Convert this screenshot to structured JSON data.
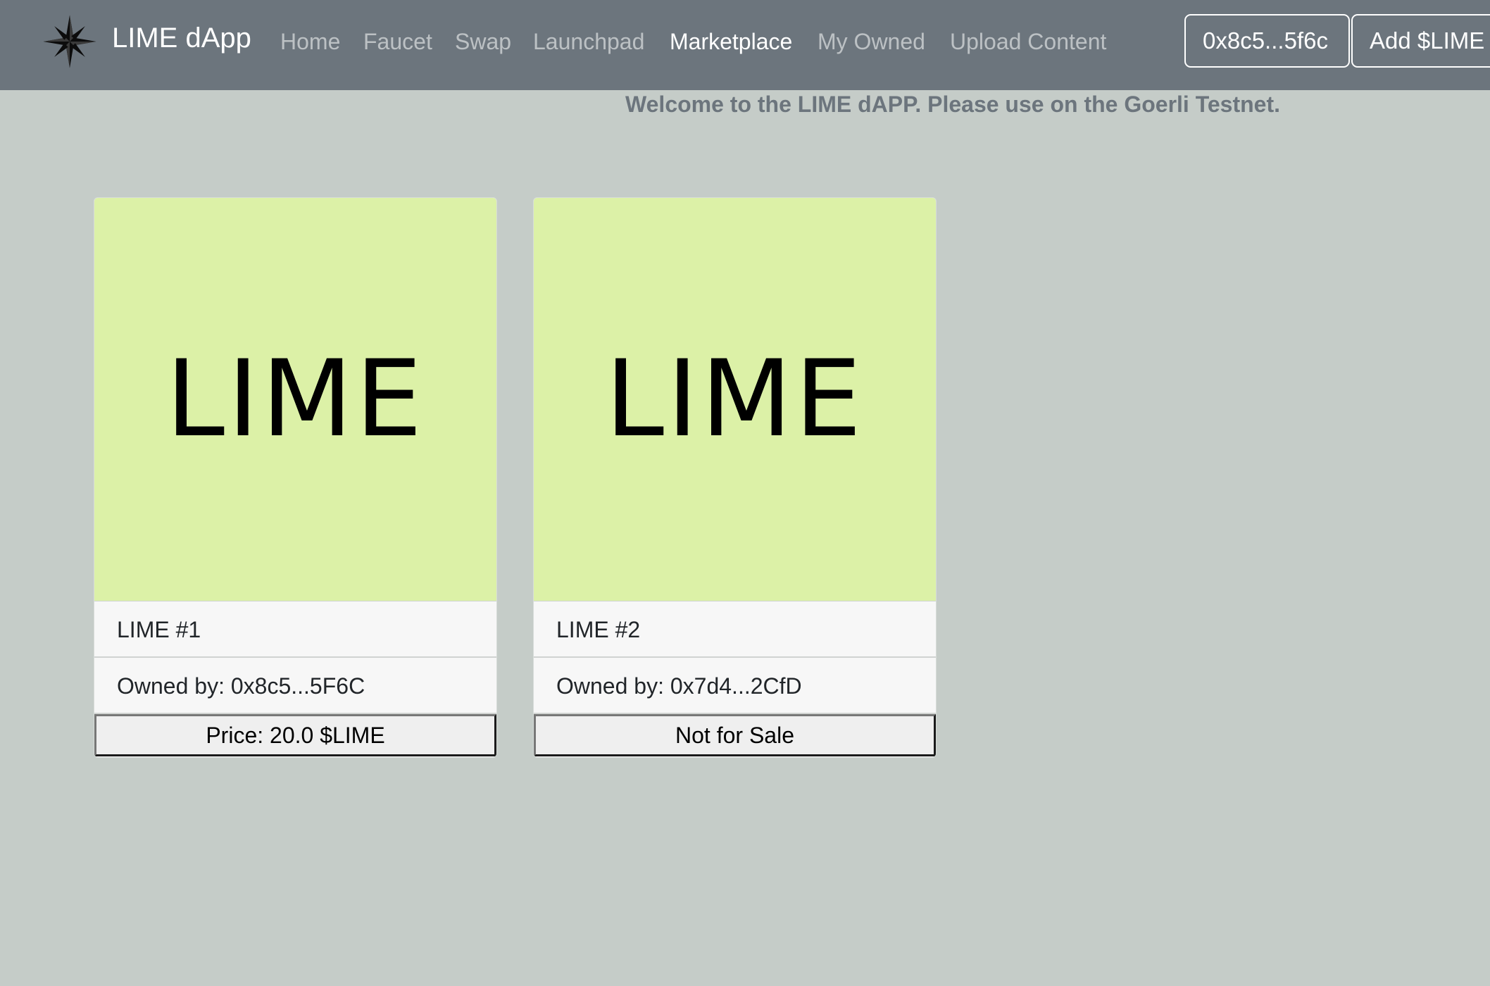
{
  "navbar": {
    "brand": "LIME dApp",
    "links": [
      "Home",
      "Faucet",
      "Swap",
      "Launchpad",
      "Marketplace",
      "My Owned",
      "Upload Content"
    ],
    "active_link": "Marketplace",
    "wallet_button": "0x8c5...5f6c",
    "add_token_button": "Add $LIME t"
  },
  "welcome_message": "Welcome to the LIME dAPP. Please use on the Goerli Testnet.",
  "cards": [
    {
      "image_text": "LIME",
      "title": "LIME #1",
      "owner": "Owned by: 0x8c5...5F6C",
      "action": "Price: 20.0 $LIME"
    },
    {
      "image_text": "LIME",
      "title": "LIME #2",
      "owner": "Owned by: 0x7d4...2CfD",
      "action": "Not for Sale"
    }
  ],
  "colors": {
    "navbar_bg": "#6c757d",
    "page_bg": "#c5ccc8",
    "nft_bg": "#dcf1a7"
  },
  "icons": {
    "brand": "compass-star-icon"
  }
}
